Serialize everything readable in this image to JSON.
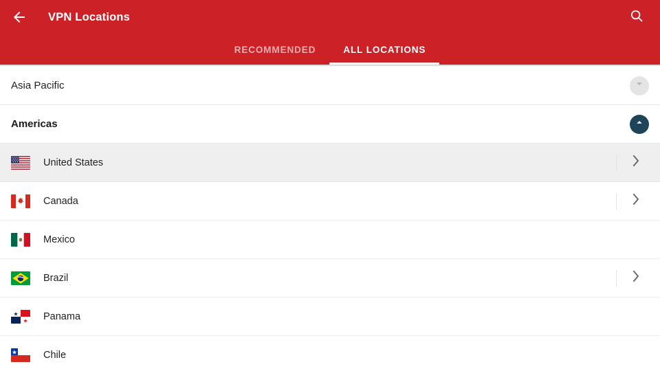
{
  "appbar": {
    "back_icon": "arrow-left-icon",
    "title": "VPN Locations",
    "search_icon": "search-icon",
    "background_color": "#cd2128"
  },
  "tabs": [
    {
      "label": "RECOMMENDED",
      "active": false
    },
    {
      "label": "ALL LOCATIONS",
      "active": true
    }
  ],
  "sections": [
    {
      "label": "Asia Pacific",
      "expanded": false,
      "toggle_icon": "chevron-down-icon",
      "toggle_color": "#e4e4e4"
    },
    {
      "label": "Americas",
      "expanded": true,
      "toggle_icon": "chevron-up-icon",
      "toggle_color": "#1d4458"
    }
  ],
  "countries": [
    {
      "name": "United States",
      "flag": "flag-united-states",
      "selected": true,
      "has_chevron": true
    },
    {
      "name": "Canada",
      "flag": "flag-canada",
      "selected": false,
      "has_chevron": true
    },
    {
      "name": "Mexico",
      "flag": "flag-mexico",
      "selected": false,
      "has_chevron": false
    },
    {
      "name": "Brazil",
      "flag": "flag-brazil",
      "selected": false,
      "has_chevron": true
    },
    {
      "name": "Panama",
      "flag": "flag-panama",
      "selected": false,
      "has_chevron": false
    },
    {
      "name": "Chile",
      "flag": "flag-chile",
      "selected": false,
      "has_chevron": false
    }
  ],
  "colors": {
    "brand_red": "#cd2128",
    "selected_row": "#efefef",
    "accent_dark": "#1d4458",
    "text_primary": "#222222"
  }
}
